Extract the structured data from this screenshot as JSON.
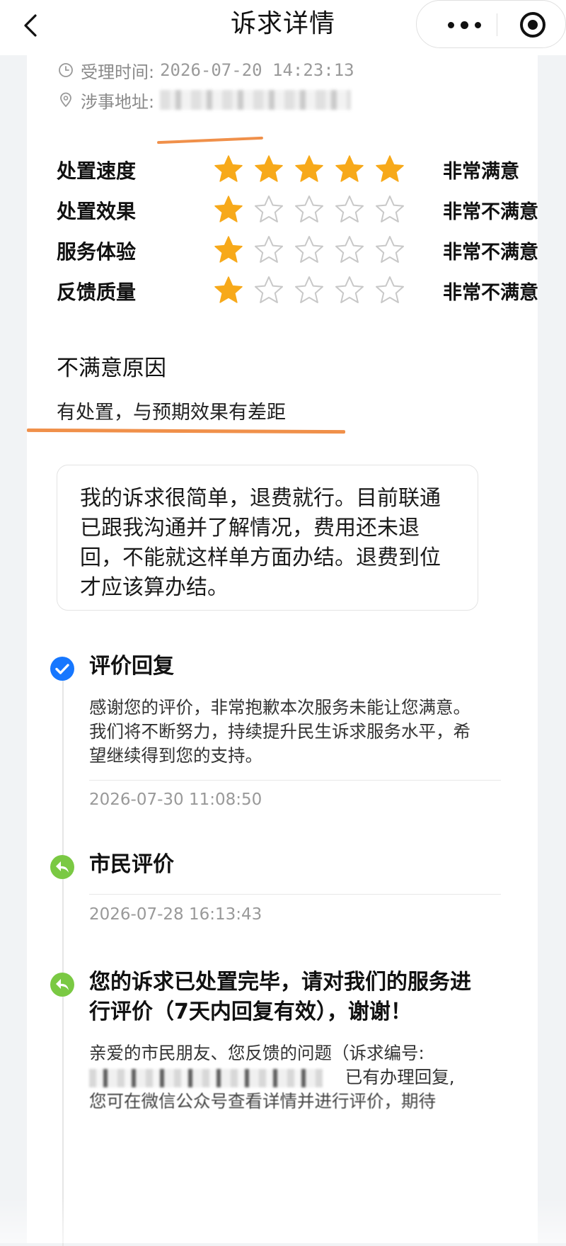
{
  "navbar": {
    "title": "诉求详情",
    "back_icon": "chevron-left-icon",
    "more_icon": "more-dots-icon",
    "close_icon": "target-close-icon"
  },
  "meta": {
    "accept_time_label": "受理时间:",
    "accept_time_value": "2026-07-20 14:23:13",
    "address_label": "涉事地址:"
  },
  "ratings": [
    {
      "label": "处置速度",
      "stars": 5,
      "max": 5,
      "text": "非常满意"
    },
    {
      "label": "处置效果",
      "stars": 1,
      "max": 5,
      "text": "非常不满意"
    },
    {
      "label": "服务体验",
      "stars": 1,
      "max": 5,
      "text": "非常不满意"
    },
    {
      "label": "反馈质量",
      "stars": 1,
      "max": 5,
      "text": "非常不满意"
    }
  ],
  "reason": {
    "title": "不满意原因",
    "text": "有处置，与预期效果有差距"
  },
  "comment": "我的诉求很简单，退费就行。目前联通已跟我沟通并了解情况，费用还未退回，不能就这样单方面办结。退费到位才应该算办结。",
  "timeline": [
    {
      "icon": "check-circle-icon",
      "title": "评价回复",
      "body": "感谢您的评价，非常抱歉本次服务未能让您满意。我们将不断努力，持续提升民生诉求服务水平，希望继续得到您的支持。",
      "time": "2026-07-30 11:08:50"
    },
    {
      "icon": "reply-arrow-icon",
      "title": "市民评价",
      "time": "2026-07-28 16:13:43"
    },
    {
      "icon": "reply-arrow-icon",
      "title": "您的诉求已处置完毕，请对我们的服务进行评价（7天内回复有效），谢谢！",
      "body_line1": "亲爱的市民朋友、您反馈的问题（诉求编号:",
      "body_line2_tail": "已有办理回复,",
      "body_line3": "您可在微信公众号查看详情并进行评价，期待"
    }
  ],
  "colors": {
    "star_filled": "#f7a91a",
    "star_empty": "#c8c8c8",
    "check_icon_bg": "#1677ff",
    "reply_icon_bg": "#7ac943",
    "highlight_underline": "#f0904a"
  }
}
